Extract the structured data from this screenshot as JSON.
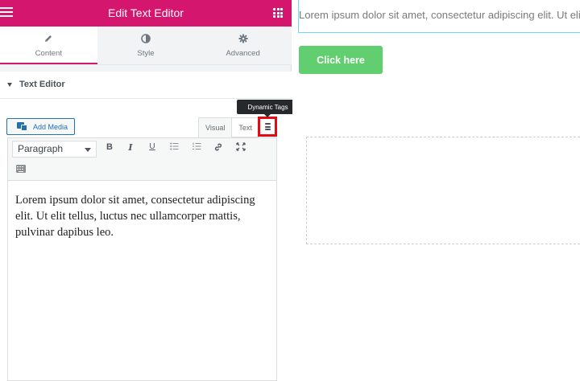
{
  "header": {
    "title": "Edit Text Editor",
    "menu_icon": "hamburger-icon",
    "apps_icon": "grid-icon",
    "bg_color": "#d5166e"
  },
  "tabs": [
    {
      "label": "Content",
      "icon": "pencil-icon"
    },
    {
      "label": "Style",
      "icon": "contrast-icon"
    },
    {
      "label": "Advanced",
      "icon": "gear-icon"
    }
  ],
  "section": {
    "title": "Text Editor"
  },
  "editor": {
    "add_media_label": "Add Media",
    "visual_label": "Visual",
    "text_label": "Text",
    "tooltip": "Dynamic Tags",
    "format_value": "Paragraph",
    "toolbar": {
      "bold": "B",
      "italic": "I",
      "underline": "U",
      "bullets": "☰",
      "numbers": "☰",
      "link": "🔗",
      "fullscreen": "⤧"
    },
    "content": "Lorem ipsum dolor sit amet, consectetur adipiscing elit. Ut elit tellus, luctus nec ullamcorper mattis, pulvinar dapibus leo."
  },
  "preview": {
    "text": "Lorem ipsum dolor sit amet, consectetur adipiscing elit. Ut elit tellus, luctus nec ullamcorper mattis, pulvinar dapibus leo.",
    "button_label": "Click here",
    "button_color": "#61ce70"
  }
}
